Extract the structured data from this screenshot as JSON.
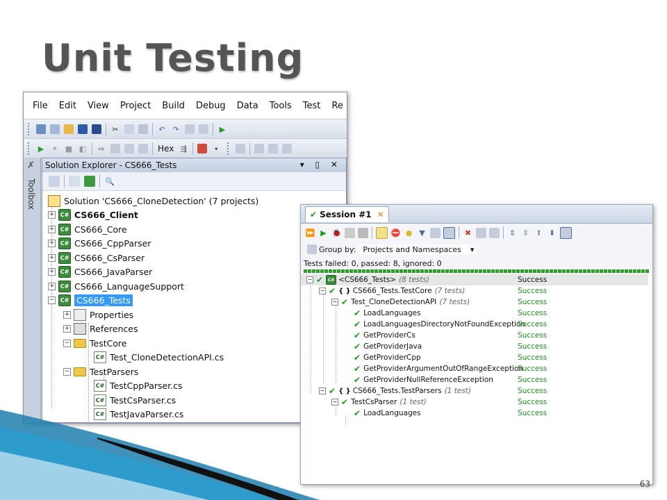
{
  "slide": {
    "title": "Unit Testing",
    "page_number": "63"
  },
  "vs": {
    "menu": [
      "File",
      "Edit",
      "View",
      "Project",
      "Build",
      "Debug",
      "Data",
      "Tools",
      "Test",
      "Re"
    ],
    "toolbar2_text": "Hex",
    "toolbox_label": "Toolbox",
    "solution_explorer": {
      "title": "Solution Explorer - CS666_Tests",
      "controls": "▾ ▯ ✕",
      "solution_label": "Solution 'CS666_CloneDetection' (7 projects)",
      "projects": [
        "CS666_Client",
        "CS666_Core",
        "CS666_CppParser",
        "CS666_CsParser",
        "CS666_JavaParser",
        "CS666_LanguageSupport",
        "CS666_Tests"
      ],
      "selected_project": "CS666_Tests",
      "properties": "Properties",
      "references": "References",
      "folders": [
        {
          "name": "TestCore",
          "files": [
            "Test_CloneDetectionAPI.cs"
          ]
        },
        {
          "name": "TestParsers",
          "files": [
            "TestCppParser.cs",
            "TestCsParser.cs",
            "TestJavaParser.cs"
          ]
        }
      ]
    }
  },
  "tests": {
    "tab_label": "Session #1",
    "group_by_label": "Group by:",
    "group_by_value": "Projects and Namespaces",
    "status_text": "Tests failed: 0, passed: 8, ignored: 0",
    "status_color": "#2aa02a",
    "rows": [
      {
        "label": "<CS666_Tests>",
        "count": "(8 tests)",
        "status": "Success"
      },
      {
        "label": "CS666_Tests.TestCore",
        "count": "(7 tests)",
        "status": "Success"
      },
      {
        "label": "Test_CloneDetectionAPI",
        "count": "(7 tests)",
        "status": "Success"
      },
      {
        "label": "LoadLanguages",
        "count": "",
        "status": "Success"
      },
      {
        "label": "LoadLanguagesDirectoryNotFoundException",
        "count": "",
        "status": "Success"
      },
      {
        "label": "GetProviderCs",
        "count": "",
        "status": "Success"
      },
      {
        "label": "GetProviderJava",
        "count": "",
        "status": "Success"
      },
      {
        "label": "GetProviderCpp",
        "count": "",
        "status": "Success"
      },
      {
        "label": "GetProviderArgumentOutOfRangeException",
        "count": "",
        "status": "Success"
      },
      {
        "label": "GetProviderNullReferenceException",
        "count": "",
        "status": "Success"
      },
      {
        "label": "CS666_Tests.TestParsers",
        "count": "(1 test)",
        "status": "Success"
      },
      {
        "label": "TestCsParser",
        "count": "(1 test)",
        "status": "Success"
      },
      {
        "label": "LoadLanguages",
        "count": "",
        "status": "Success"
      }
    ]
  }
}
